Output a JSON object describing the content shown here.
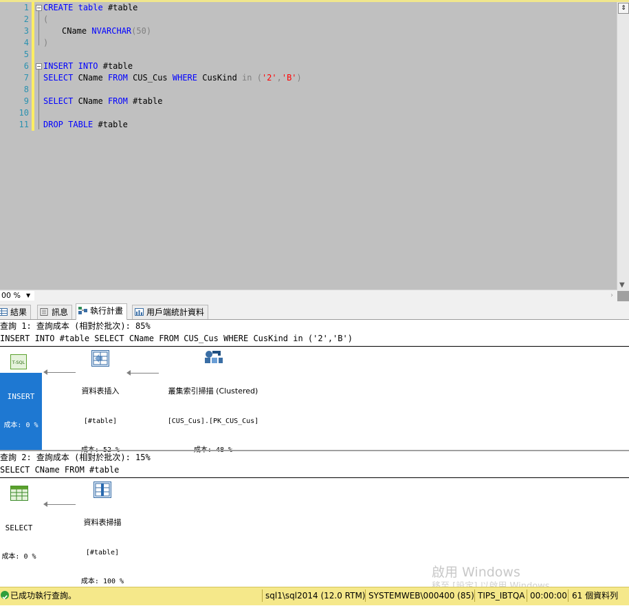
{
  "editor": {
    "line_numbers": [
      "1",
      "2",
      "3",
      "4",
      "5",
      "6",
      "7",
      "8",
      "9",
      "10",
      "11"
    ],
    "lines": {
      "l1": {
        "kw1": "CREATE",
        "kw2": "table",
        "rest": " #table"
      },
      "l2": {
        "text": "("
      },
      "l3": {
        "name": "CName ",
        "type": "NVARCHAR",
        "args": "(50)"
      },
      "l4": {
        "text": ")"
      },
      "l6": {
        "kw1": "INSERT",
        "kw2": "INTO",
        "rest": " #table"
      },
      "l7": {
        "kw1": "SELECT",
        "name": " CName ",
        "kw2": "FROM",
        "tbl": " CUS_Cus ",
        "kw3": "WHERE",
        "col": " CusKind ",
        "op": "in",
        "p1": " (",
        "s1": "'2'",
        "comma": ",",
        "s2": "'B'",
        "p2": ")"
      },
      "l9": {
        "kw1": "SELECT",
        "name": " CName ",
        "kw2": "FROM",
        "rest": " #table"
      },
      "l11": {
        "kw1": "DROP",
        "kw2": "TABLE",
        "rest": " #table"
      }
    },
    "zoom": "00 %"
  },
  "tabs": [
    {
      "label": "結果",
      "icon": "grid-icon"
    },
    {
      "label": "訊息",
      "icon": "message-icon"
    },
    {
      "label": "執行計畫",
      "icon": "execution-plan-icon"
    },
    {
      "label": "用戶端統計資料",
      "icon": "statistics-icon"
    }
  ],
  "plan": {
    "q1": {
      "header": "查詢 1: 查詢成本 (相對於批次): 85%",
      "sql": "INSERT INTO #table SELECT CName FROM CUS_Cus WHERE CusKind in ('2','B')",
      "node_root": {
        "title": "INSERT",
        "cost": "成本: 0 %",
        "icon": "tsql-icon",
        "badge": "T-SQL"
      },
      "node_insert": {
        "title": "資料表插入",
        "object": "[#table]",
        "cost": "成本: 52 %",
        "icon": "table-insert-icon"
      },
      "node_scan": {
        "title": "叢集索引掃描 (Clustered)",
        "object": "[CUS_Cus].[PK_CUS_Cus]",
        "cost": "成本: 48 %",
        "icon": "clustered-index-scan-icon"
      }
    },
    "q2": {
      "header": "查詢 2: 查詢成本 (相對於批次): 15%",
      "sql": "SELECT CName FROM #table",
      "node_root": {
        "title": "SELECT",
        "cost": "成本: 0 %",
        "icon": "select-icon"
      },
      "node_scan": {
        "title": "資料表掃描",
        "object": "[#table]",
        "cost": "成本: 100 %",
        "icon": "table-scan-icon"
      }
    }
  },
  "watermark": {
    "line1": "啟用 Windows",
    "line2": "移至 [設定] 以啟用 Windows。"
  },
  "status": {
    "message": "已成功執行查詢。",
    "server": "sql1\\sql2014 (12.0 RTM)",
    "login": "SYSTEMWEB\\000400 (85)",
    "database": "TIPS_IBTQA",
    "elapsed": "00:00:00",
    "rows": "61 個資料列"
  },
  "colors": {
    "editor_bg": "#c0c0c0",
    "keyword": "#0000ff",
    "string": "#ff0000",
    "status_bg": "#f5e88a",
    "selected": "#1e78d2"
  }
}
